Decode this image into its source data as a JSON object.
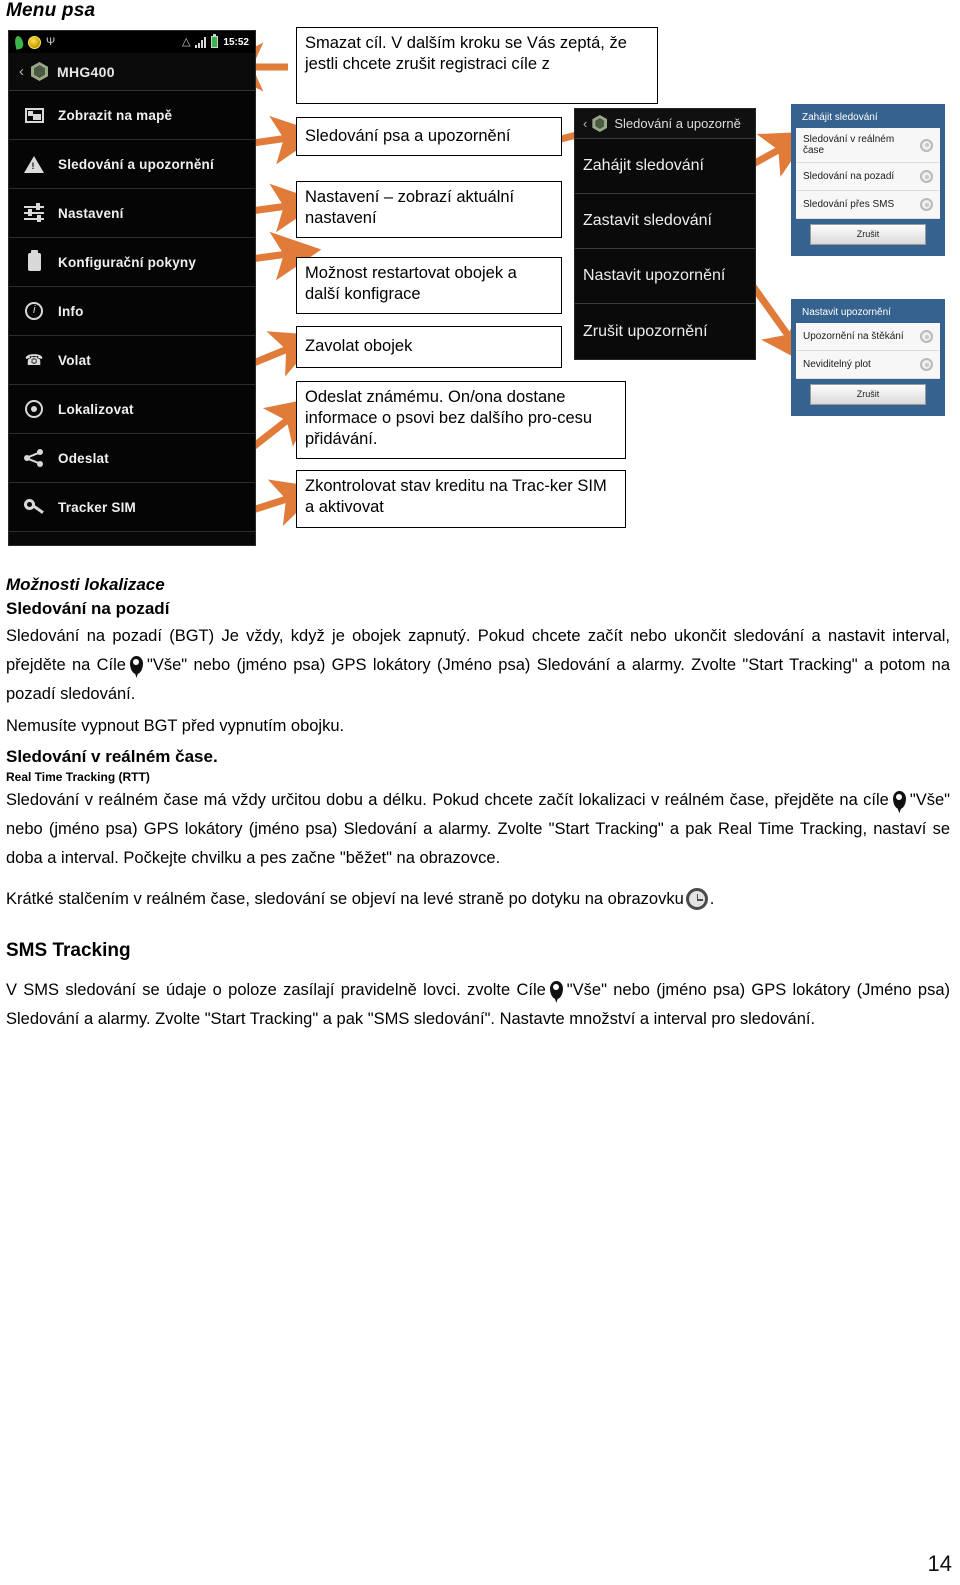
{
  "page": {
    "heading": "Menu psa",
    "number": "14"
  },
  "phone_main": {
    "status_bar": {
      "time": "15:52",
      "icons_left": [
        "leaf-icon",
        "coin-icon",
        "usb-icon"
      ],
      "icons_right": [
        "wifi-icon",
        "signal-icon",
        "battery-icon"
      ]
    },
    "title": "MHG400",
    "back_icon": "‹",
    "delete_icon": "trash-icon",
    "menu_items": [
      {
        "label": "Zobrazit na mapě",
        "icon": "map-icon"
      },
      {
        "label": "Sledování a upozornění",
        "icon": "warning-icon"
      },
      {
        "label": "Nastavení",
        "icon": "sliders-icon"
      },
      {
        "label": "Konfigurační pokyny",
        "icon": "document-icon"
      },
      {
        "label": "Info",
        "icon": "info-icon"
      },
      {
        "label": "Volat",
        "icon": "phone-icon"
      },
      {
        "label": "Lokalizovat",
        "icon": "target-icon"
      },
      {
        "label": "Odeslat",
        "icon": "share-icon"
      },
      {
        "label": "Tracker SIM",
        "icon": "key-icon"
      }
    ]
  },
  "phone_sub": {
    "back_icon": "‹",
    "title": "Sledování a upozorně",
    "items": [
      {
        "label": "Zahájit sledování"
      },
      {
        "label": "Zastavit sledování"
      },
      {
        "label": "Nastavit upozornění"
      },
      {
        "label": "Zrušit upozornění"
      }
    ]
  },
  "dialog_tracking": {
    "title": "Zahájit sledování",
    "options": [
      "Sledování v reálném čase",
      "Sledování na pozadí",
      "Sledování přes SMS"
    ],
    "cancel_label": "Zrušit",
    "accent_color": "#35628e"
  },
  "dialog_alerts": {
    "title": "Nastavit upozornění",
    "options": [
      "Upozornění na štěkání",
      "Neviditelný plot"
    ],
    "cancel_label": "Zrušit",
    "accent_color": "#35628e"
  },
  "callouts": {
    "delete_target": "Smazat cíl. V dalším kroku se Vás zeptá, že jestli chcete zrušit registraci cíle z",
    "tracking": "Sledování psa a upozornění",
    "settings": "Nastavení – zobrazí aktuální nastavení",
    "config": "Možnost restartovat obojek a další konfigrace",
    "call": "Zavolat obojek",
    "send": "Odeslat známému. On/ona dostane informace o psovi bez dalšího pro-cesu přidávání.",
    "sim": "Zkontrolovat stav kreditu na Trac-ker SIM a aktivovat"
  },
  "body": {
    "h_options": "Možnosti lokalizace",
    "h_background": "Sledování na pozadí",
    "p_bg_1a": "Sledování na pozadí (BGT) Je vždy, když je obojek zapnutý. Pokud chcete začít nebo ukončit sledování a nastavit interval, přejděte na Cíle",
    "p_bg_1b": "\"Vše\" nebo (jméno psa) GPS lokátory (Jméno psa) Sledování a alarmy. Zvolte \"Start Tracking\" a potom na pozadí sledování.",
    "p_bg_2": "Nemusíte vypnout BGT před vypnutím obojku.",
    "h_realtime": "Sledování v reálném čase.",
    "h_rtt": "Real Time Tracking (RTT)",
    "p_rtt_1a": "Sledování v reálném čase má vždy určitou dobu a délku. Pokud chcete začít lokalizaci v reálném čase, přejděte na cíle",
    "p_rtt_1b": "\"Vše\" nebo (jméno psa) GPS lokátory (jméno psa) Sledování a alarmy. Zvolte \"Start Tracking\" a pak Real Time Tracking, nastaví se doba a interval. Počkejte chvilku a pes začne \"běžet\" na obrazovce.",
    "p_rtt_2a": "Krátké stalčením v reálném čase, sledování se objeví na levé straně po dotyku na obrazovku",
    "p_rtt_2b": ".",
    "h_sms": "SMS Tracking",
    "p_sms_a": "V SMS sledování se údaje o poloze zasílají pravidelně lovci. zvolte Cíle",
    "p_sms_b": "\"Vše\" nebo (jméno psa) GPS lokátory (Jméno psa) Sledování a alarmy. Zvolte \"Start Tracking\" a pak \"SMS sledování\". Nastavte množství a interval pro sledování."
  },
  "arrow_color": "#e07b39"
}
